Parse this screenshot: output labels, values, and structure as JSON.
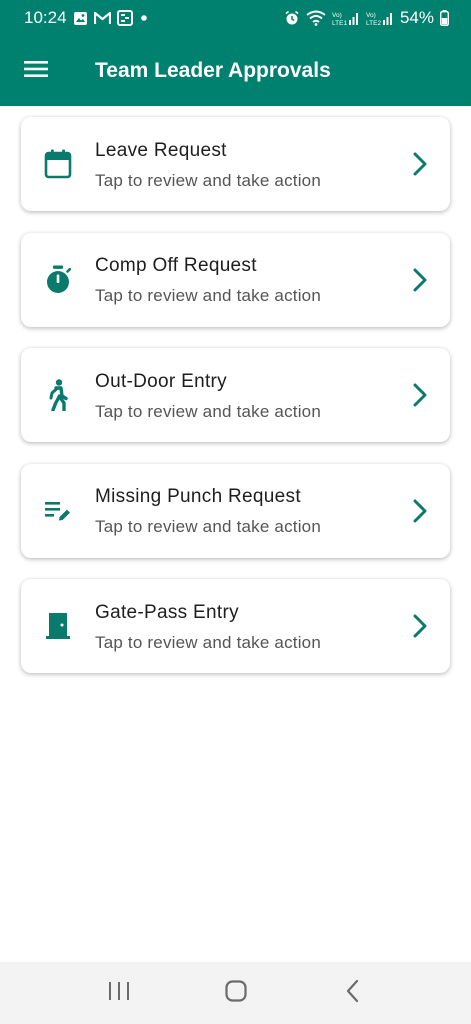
{
  "status_bar": {
    "time": "10:24",
    "battery": "54%",
    "network_1": "Vo) LTE1",
    "network_2": "Vo) LTE2"
  },
  "app_bar": {
    "title": "Team Leader Approvals",
    "menu_icon": "menu-icon",
    "background": "#00806e"
  },
  "cards": [
    {
      "title": "Leave Request",
      "subtitle": "Tap to review and take action",
      "icon": "calendar-icon"
    },
    {
      "title": "Comp Off Request",
      "subtitle": "Tap to review and take action",
      "icon": "stopwatch-icon"
    },
    {
      "title": "Out-Door Entry",
      "subtitle": "Tap to review and take action",
      "icon": "walking-person-icon"
    },
    {
      "title": "Missing Punch Request",
      "subtitle": "Tap to review and take action",
      "icon": "edit-note-icon"
    },
    {
      "title": "Gate-Pass Entry",
      "subtitle": "Tap to review and take action",
      "icon": "door-icon"
    }
  ],
  "colors": {
    "accent": "#00806e",
    "icon": "#0a7a6c"
  }
}
